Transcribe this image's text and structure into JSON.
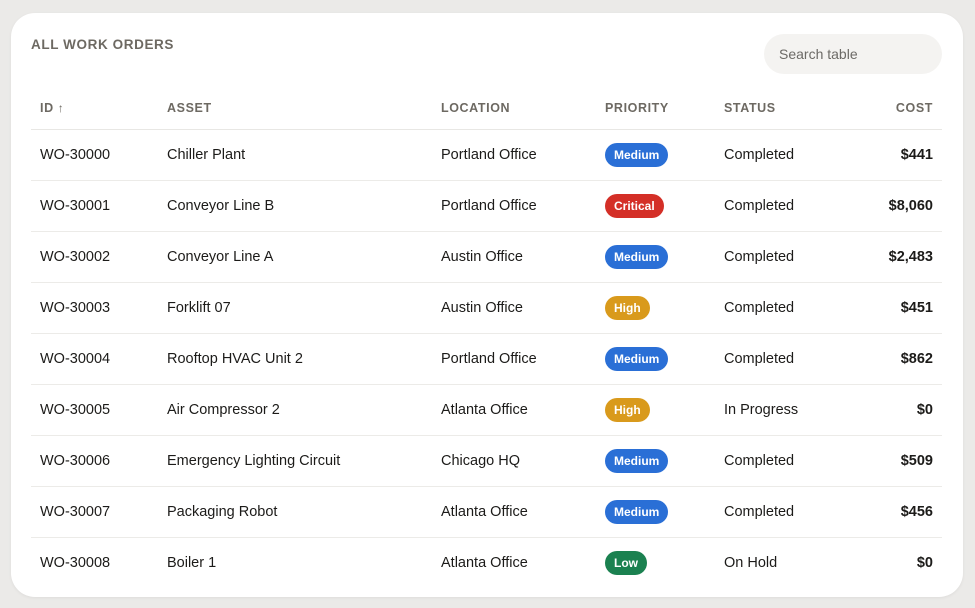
{
  "title": "ALL WORK ORDERS",
  "search": {
    "placeholder": "Search table"
  },
  "columns": {
    "id": "ID",
    "id_sort_icon": "↑",
    "asset": "ASSET",
    "location": "LOCATION",
    "priority": "PRIORITY",
    "status": "STATUS",
    "cost": "COST"
  },
  "priority_colors": {
    "Medium": "#2a6fd6",
    "Critical": "#d42f27",
    "High": "#d99a1c",
    "Low": "#1b8150"
  },
  "rows": [
    {
      "id": "WO-30000",
      "asset": "Chiller Plant",
      "location": "Portland Office",
      "priority": "Medium",
      "status": "Completed",
      "cost": "$441"
    },
    {
      "id": "WO-30001",
      "asset": "Conveyor Line B",
      "location": "Portland Office",
      "priority": "Critical",
      "status": "Completed",
      "cost": "$8,060"
    },
    {
      "id": "WO-30002",
      "asset": "Conveyor Line A",
      "location": "Austin Office",
      "priority": "Medium",
      "status": "Completed",
      "cost": "$2,483"
    },
    {
      "id": "WO-30003",
      "asset": "Forklift 07",
      "location": "Austin Office",
      "priority": "High",
      "status": "Completed",
      "cost": "$451"
    },
    {
      "id": "WO-30004",
      "asset": "Rooftop HVAC Unit 2",
      "location": "Portland Office",
      "priority": "Medium",
      "status": "Completed",
      "cost": "$862"
    },
    {
      "id": "WO-30005",
      "asset": "Air Compressor 2",
      "location": "Atlanta Office",
      "priority": "High",
      "status": "In Progress",
      "cost": "$0"
    },
    {
      "id": "WO-30006",
      "asset": "Emergency Lighting Circuit",
      "location": "Chicago HQ",
      "priority": "Medium",
      "status": "Completed",
      "cost": "$509"
    },
    {
      "id": "WO-30007",
      "asset": "Packaging Robot",
      "location": "Atlanta Office",
      "priority": "Medium",
      "status": "Completed",
      "cost": "$456"
    },
    {
      "id": "WO-30008",
      "asset": "Boiler 1",
      "location": "Atlanta Office",
      "priority": "Low",
      "status": "On Hold",
      "cost": "$0"
    }
  ]
}
